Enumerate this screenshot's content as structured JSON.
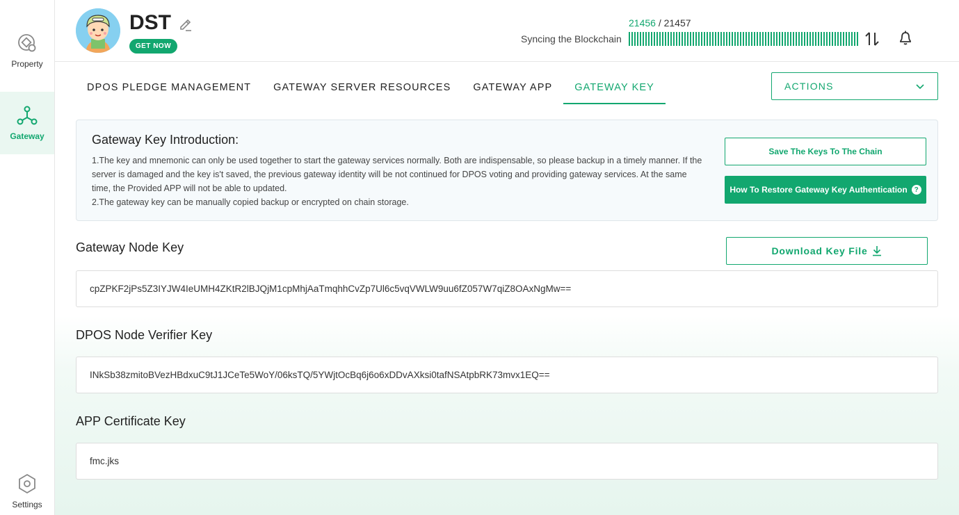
{
  "sidebar": {
    "items": [
      {
        "label": "Property",
        "icon": "property-icon"
      },
      {
        "label": "Gateway",
        "icon": "gateway-icon",
        "active": true
      },
      {
        "label": "Settings",
        "icon": "settings-icon"
      }
    ]
  },
  "header": {
    "title": "DST",
    "get_now_label": "GET NOW",
    "sync_label": "Syncing the Blockchain",
    "sync_current": "21456",
    "sync_separator": " / ",
    "sync_total": "21457",
    "sync_progress": 0.99995
  },
  "tabs": [
    {
      "label": "DPOS PLEDGE MANAGEMENT"
    },
    {
      "label": "GATEWAY SERVER RESOURCES"
    },
    {
      "label": "GATEWAY APP"
    },
    {
      "label": "GATEWAY KEY",
      "active": true
    }
  ],
  "actions_label": "ACTIONS",
  "intro": {
    "title": "Gateway Key Introduction:",
    "line1": "1.The key and mnemonic can only be used together to start the gateway services normally. Both are indispensable, so please backup in a timely manner. If the server is damaged and the key is't saved, the previous gateway identity will be not continued for DPOS voting and providing gateway services. At the same time, the Provided APP will not be able to updated.",
    "line2": "2.The gateway key can be manually copied backup or encrypted on chain storage.",
    "save_button": "Save The Keys To The Chain",
    "restore_button": "How To Restore Gateway Key Authentication"
  },
  "node_key": {
    "label": "Gateway Node Key",
    "download_label": "Download Key File",
    "value": "cpZPKF2jPs5Z3IYJW4IeUMH4ZKtR2lBJQjM1cpMhjAaTmqhhCvZp7Ul6c5vqVWLW9uu6fZ057W7qiZ8OAxNgMw=="
  },
  "verifier_key": {
    "label": "DPOS Node Verifier Key",
    "value": "INkSb38zmitoBVezHBdxuC9tJ1JCeTe5WoY/06ksTQ/5YWjtOcBq6j6o6xDDvAXksi0tafNSAtpbRK73mvx1EQ=="
  },
  "cert_key": {
    "label": "APP Certificate Key",
    "value": "fmc.jks"
  },
  "colors": {
    "accent": "#12a76f",
    "active_bg": "#eaf7f1"
  }
}
